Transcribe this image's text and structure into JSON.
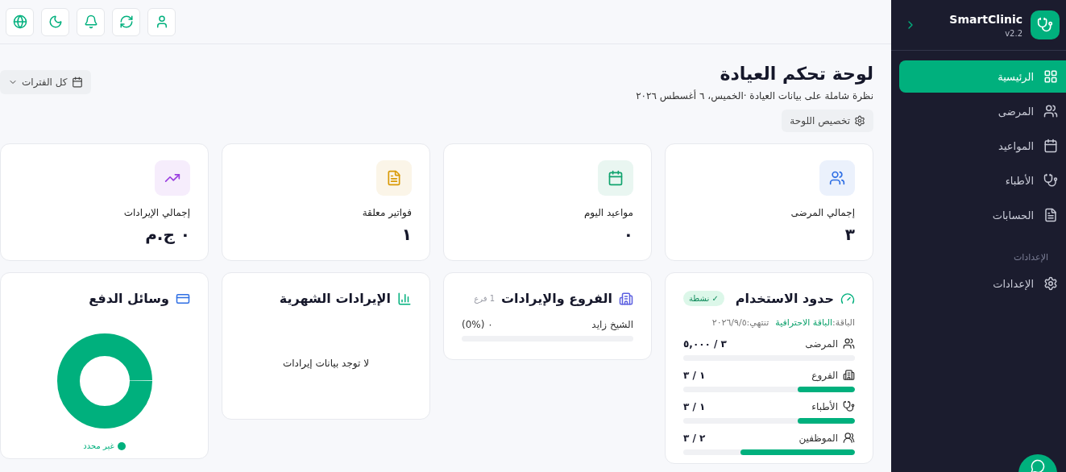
{
  "sidebar": {
    "brand": "SmartClinic",
    "version": "v2.2",
    "items": [
      {
        "label": "الرئيسية",
        "selected": true
      },
      {
        "label": "المرضى",
        "selected": false
      },
      {
        "label": "المواعيد",
        "selected": false
      },
      {
        "label": "الأطباء",
        "selected": false
      },
      {
        "label": "الحسابات",
        "selected": false
      }
    ],
    "section_label": "الإعدادات",
    "settings_items": [
      {
        "label": "الإعدادات",
        "selected": false
      }
    ]
  },
  "header": {
    "title": "لوحة تحكم العيادة",
    "subtitle": "نظرة شاملة على بيانات العيادة ·الخميس، ٦ أغسطس ٢٠٢٦",
    "customize_button": "تخصيص اللوحة",
    "period_filter": "كل الفترات"
  },
  "stats": [
    {
      "label": "إجمالي المرضى",
      "value": "٣",
      "color": "#2f6fe4"
    },
    {
      "label": "مواعيد اليوم",
      "value": "٠",
      "color": "#10a36e"
    },
    {
      "label": "فواتير معلقة",
      "value": "١",
      "color": "#d99a06"
    },
    {
      "label": "إجمالي الإيرادات",
      "value": "٠ ج.م",
      "color": "#9b3fe0"
    }
  ],
  "usage": {
    "title": "حدود الاستخدام",
    "badge": "✓ نشطة",
    "plan_label": "الباقة:",
    "plan_name": "الباقة الاحترافية",
    "expiry": "تنتهي:٢٠٢٦/٩/٥",
    "rows": [
      {
        "label": "المرضى",
        "value": "٣ / ٥,٠٠٠",
        "level": 0.0006
      },
      {
        "label": "الفروع",
        "value": "١ / ٣",
        "level": 0.333
      },
      {
        "label": "الأطباء",
        "value": "١ / ٣",
        "level": 0.333
      },
      {
        "label": "الموظفين",
        "value": "٢ / ٣",
        "level": 0.667
      }
    ]
  },
  "branches": {
    "title": "الفروع والإيرادات",
    "count": "1 فرع",
    "rows": [
      {
        "name": "الشيخ زايد",
        "value": "٠ (0%)"
      }
    ]
  },
  "monthly_revenue": {
    "title": "الإيرادات الشهرية",
    "empty_text": "لا توجد بيانات إيرادات"
  },
  "payment_methods": {
    "title": "وسائل الدفع",
    "legend": [
      {
        "label": "غير محدد",
        "color": "#00b07d"
      }
    ]
  }
}
